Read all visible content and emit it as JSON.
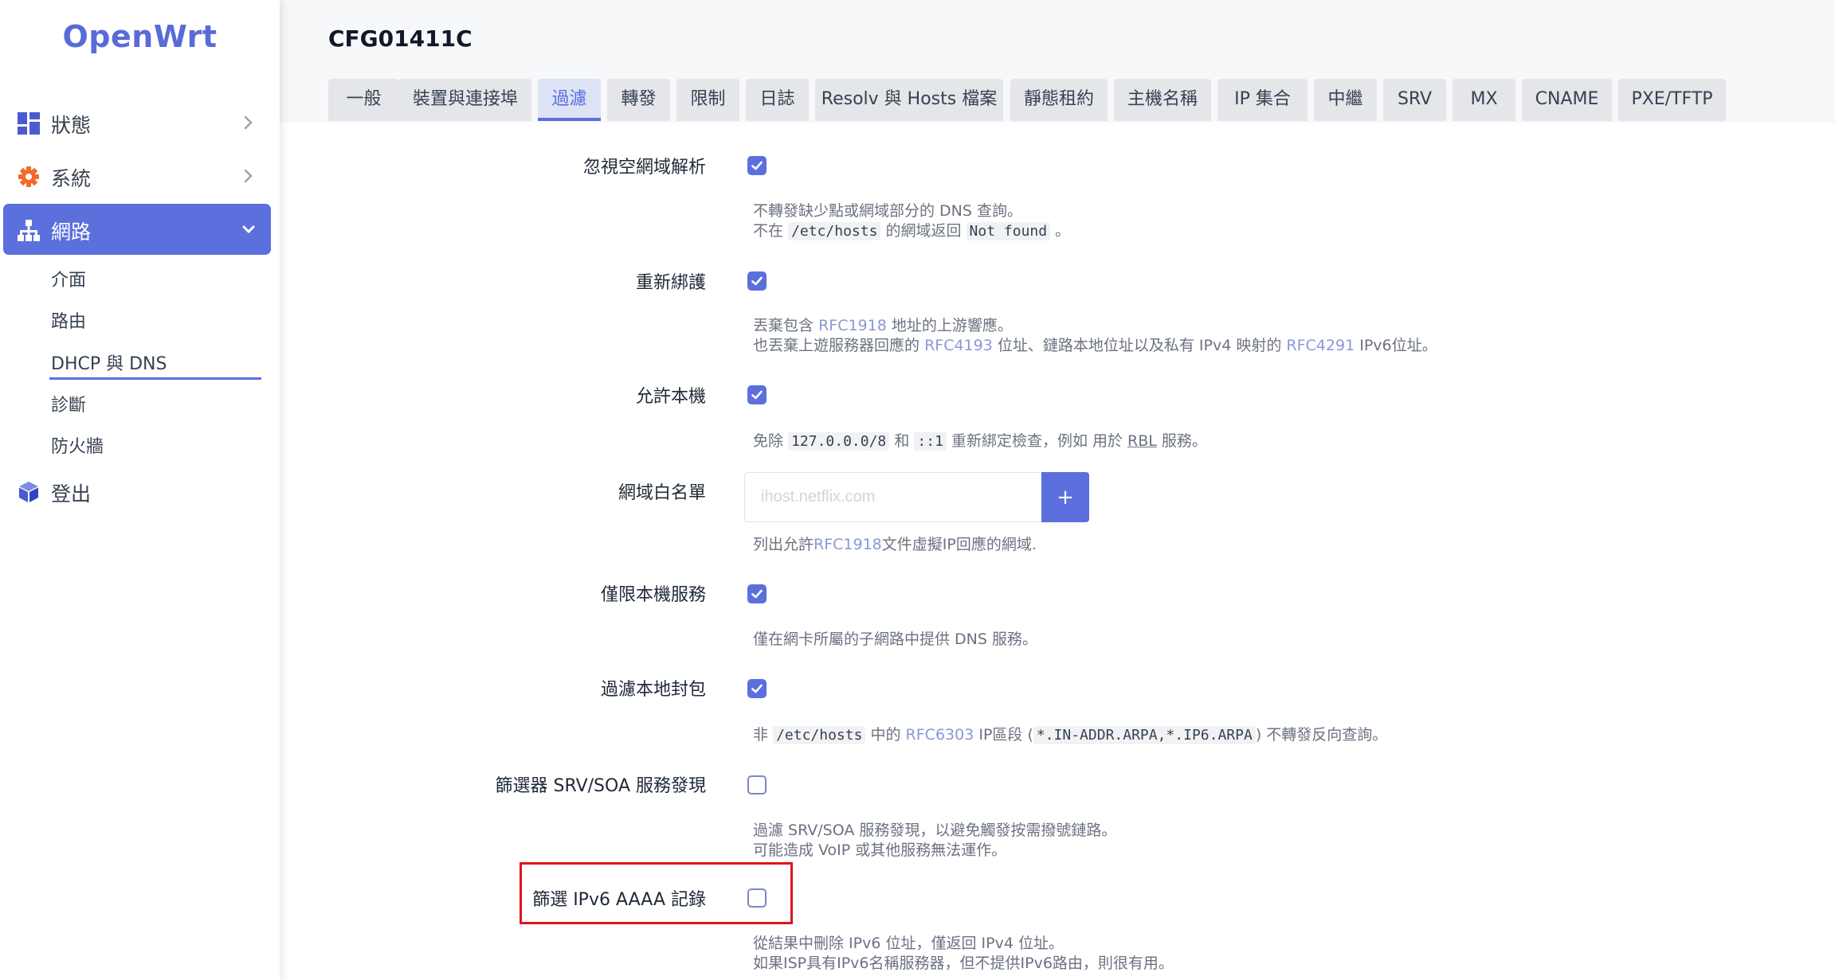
{
  "app": {
    "logo": "OpenWrt",
    "page_title": "CFG01411C"
  },
  "sidebar": {
    "items": [
      {
        "label": "狀態",
        "icon": "dashboard-icon",
        "expanded": false
      },
      {
        "label": "系統",
        "icon": "gear-icon",
        "expanded": false
      },
      {
        "label": "網路",
        "icon": "network-icon",
        "expanded": true,
        "active": true
      },
      {
        "label": "登出",
        "icon": "cube-icon"
      }
    ],
    "subitems": [
      {
        "label": "介面"
      },
      {
        "label": "路由"
      },
      {
        "label": "DHCP 與 DNS",
        "active": true
      },
      {
        "label": "診斷"
      },
      {
        "label": "防火牆"
      }
    ]
  },
  "tabs": [
    {
      "label": "一般"
    },
    {
      "label": "裝置與連接埠"
    },
    {
      "label": "過濾",
      "active": true
    },
    {
      "label": "轉發"
    },
    {
      "label": "限制"
    },
    {
      "label": "日誌"
    },
    {
      "label": "Resolv 與 Hosts 檔案"
    },
    {
      "label": "靜態租約"
    },
    {
      "label": "主機名稱"
    },
    {
      "label": "IP 集合"
    },
    {
      "label": "中繼"
    },
    {
      "label": "SRV"
    },
    {
      "label": "MX"
    },
    {
      "label": "CNAME"
    },
    {
      "label": "PXE/TFTP"
    }
  ],
  "settings": {
    "domain_needed": {
      "label": "忽視空網域解析",
      "checked": true,
      "help1": "不轉發缺少點或網域部分的 DNS 查詢。",
      "help2_pre": "不在",
      "help2_code1": "/etc/hosts",
      "help2_mid": "的網域返回",
      "help2_code2": "Not found",
      "help2_post": "。"
    },
    "rebind_protection": {
      "label": "重新綁護",
      "checked": true,
      "help1_pre": "丟棄包含",
      "help1_link": "RFC1918",
      "help1_post": "地址的上游響應。",
      "help2_pre": "也丟棄上遊服務器回應的",
      "help2_link1": "RFC4193",
      "help2_mid": "位址、鏈路本地位址以及私有 IPv4 映射的",
      "help2_link2": "RFC4291",
      "help2_post": "IPv6位址。"
    },
    "rebind_localhost": {
      "label": "允許本機",
      "checked": true,
      "help_pre": "免除",
      "help_code1": "127.0.0.0/8",
      "help_and": "和",
      "help_code2": "::1",
      "help_mid": "重新綁定檢查，例如 用於",
      "help_rbl": "RBL",
      "help_post": "服務。"
    },
    "rebind_domain": {
      "label": "網域白名單",
      "placeholder": "ihost.netflix.com",
      "value": "",
      "add_label": "+",
      "help_pre": "列出允許",
      "help_link": "RFC1918",
      "help_post": "文件虛擬IP回應的網域."
    },
    "local_service": {
      "label": "僅限本機服務",
      "checked": true,
      "help": "僅在網卡所屬的子網路中提供 DNS 服務。"
    },
    "bogus_priv": {
      "label": "過濾本地封包",
      "checked": true,
      "help_pre": "非",
      "help_code1": "/etc/hosts",
      "help_mid1": "中的",
      "help_link": "RFC6303",
      "help_mid2": "IP區段 (",
      "help_code2": "*.IN-ADDR.ARPA,*.IP6.ARPA",
      "help_post": ") 不轉發反向查詢。"
    },
    "filter_srv_soa": {
      "label": "篩選器 SRV/SOA 服務發現",
      "checked": false,
      "help1": "過濾 SRV/SOA 服務發現，以避免觸發按需撥號鏈路。",
      "help2": "可能造成 VoIP 或其他服務無法運作。"
    },
    "filter_aaaa": {
      "label": "篩選 IPv6 AAAA 記錄",
      "checked": false,
      "help1": "從結果中刪除 IPv6 位址，僅返回 IPv4 位址。",
      "help2": "如果ISP具有IPv6名稱服務器，但不提供IPv6路由，則很有用。"
    }
  },
  "colors": {
    "accent": "#5b6fdd",
    "highlight": "#e0141c"
  }
}
